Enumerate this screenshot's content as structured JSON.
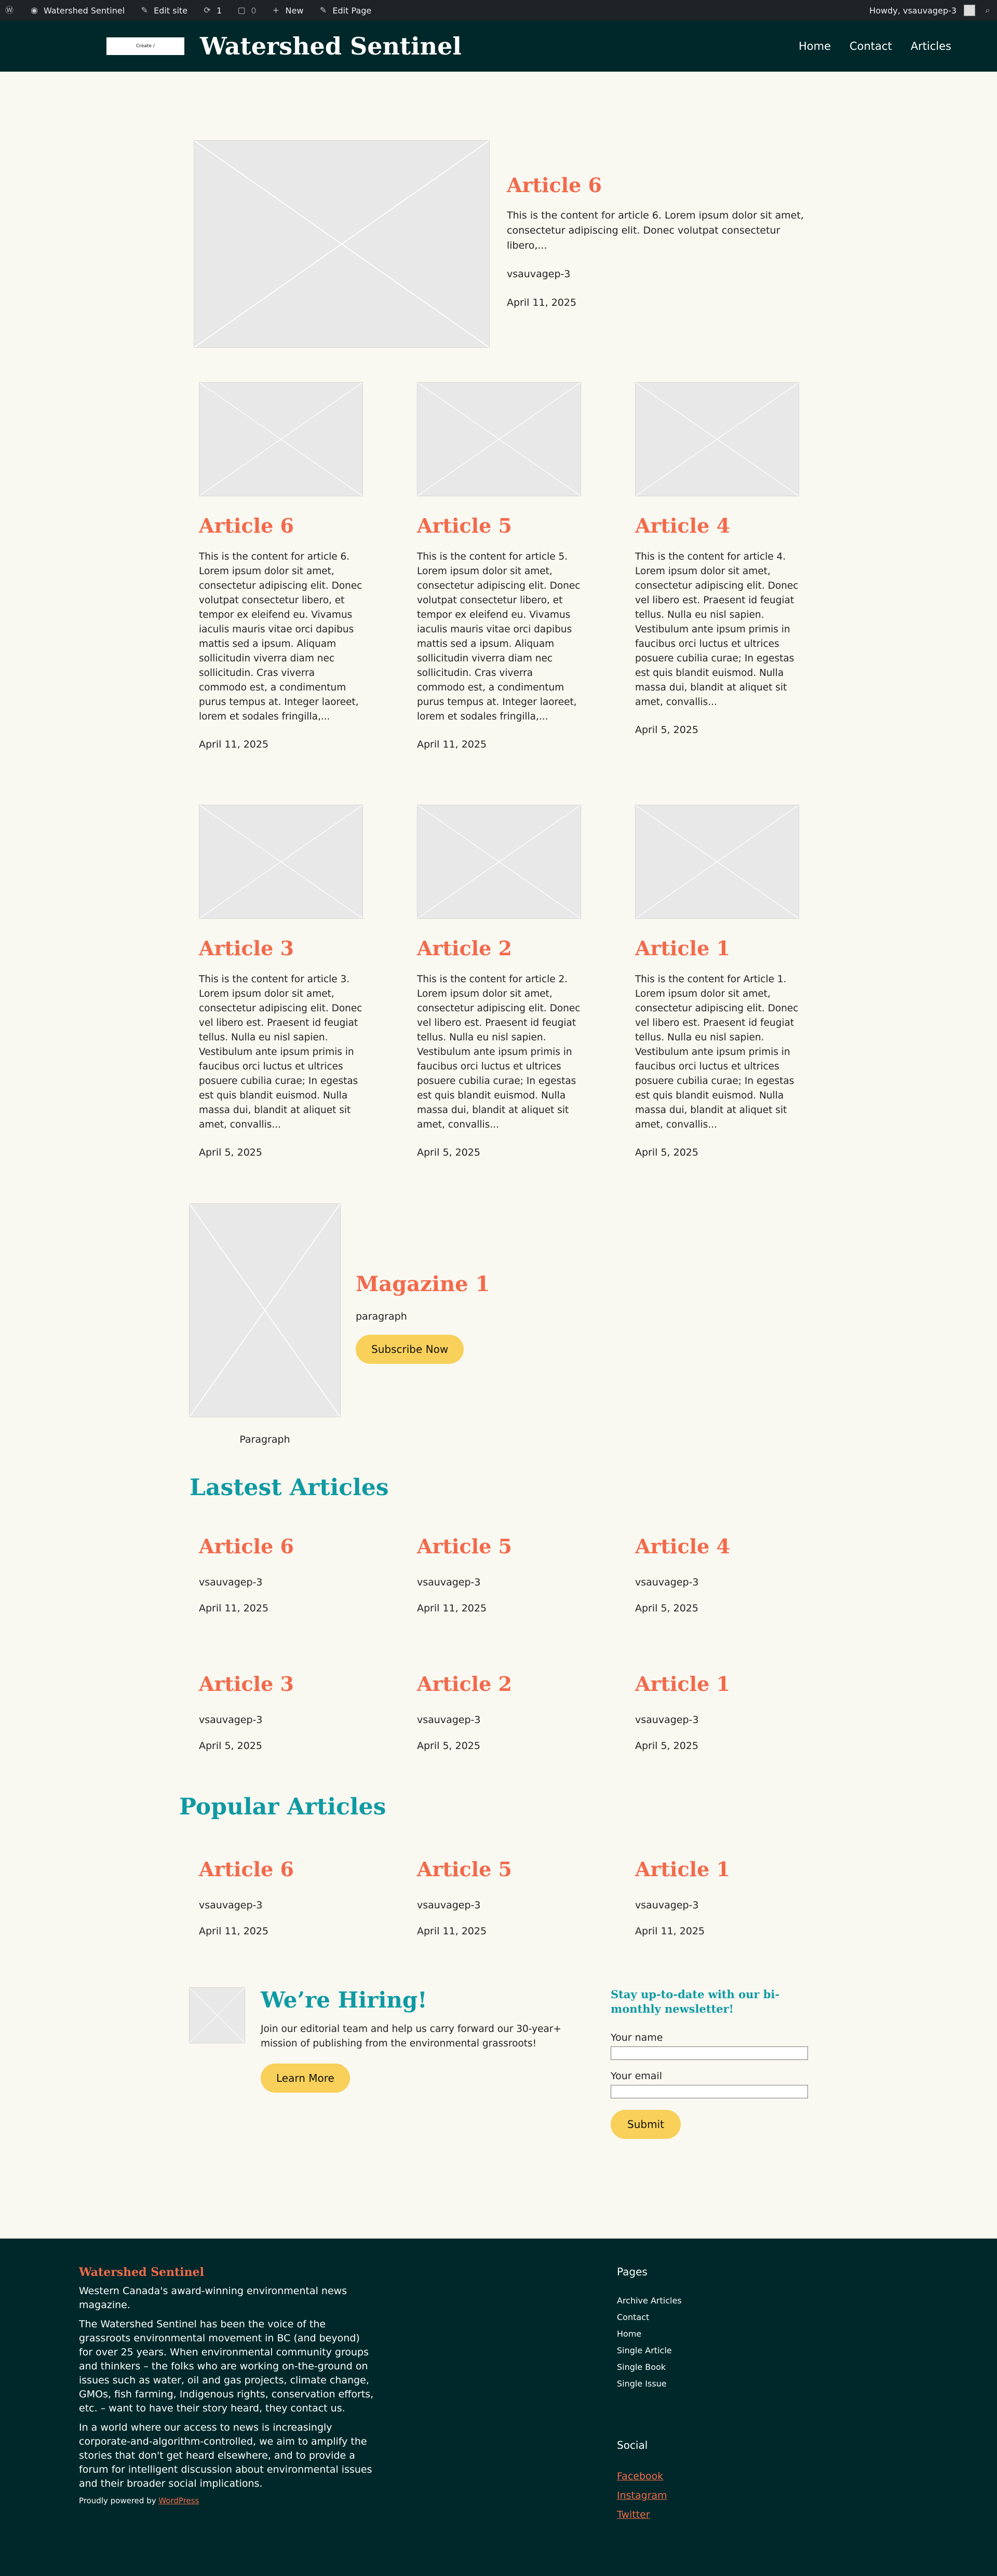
{
  "adminbar": {
    "site": "Watershed Sentinel",
    "edit_site": "Edit site",
    "updates": "1",
    "comments": "0",
    "new": "New",
    "edit_page": "Edit Page",
    "howdy": "Howdy, vsauvagep-3"
  },
  "header": {
    "logo_text": "Create /",
    "title": "Watershed Sentinel",
    "nav": [
      "Home",
      "Contact",
      "Articles"
    ]
  },
  "featured": {
    "title": "Article 6",
    "excerpt": "This is the content for article 6. Lorem ipsum dolor sit amet, consectetur adipiscing elit. Donec volutpat consectetur libero,...",
    "author": "vsauvagep-3",
    "date": "April 11, 2025"
  },
  "grid": [
    {
      "title": "Article 6",
      "excerpt": "This is the content for article 6. Lorem ipsum dolor sit amet, consectetur adipiscing elit. Donec volutpat consectetur libero, et tempor ex eleifend eu. Vivamus iaculis mauris vitae orci dapibus mattis sed a ipsum. Aliquam sollicitudin viverra diam nec sollicitudin. Cras viverra commodo est, a condimentum purus tempus at. Integer laoreet, lorem et sodales fringilla,...",
      "date": "April 11, 2025"
    },
    {
      "title": "Article 5",
      "excerpt": "This is the content for article 5. Lorem ipsum dolor sit amet, consectetur adipiscing elit. Donec volutpat consectetur libero, et tempor ex eleifend eu. Vivamus iaculis mauris vitae orci dapibus mattis sed a ipsum. Aliquam sollicitudin viverra diam nec sollicitudin. Cras viverra commodo est, a condimentum purus tempus at. Integer laoreet, lorem et sodales fringilla,...",
      "date": "April 11, 2025"
    },
    {
      "title": "Article 4",
      "excerpt": "This is the content for article 4. Lorem ipsum dolor sit amet, consectetur adipiscing elit. Donec vel libero est. Praesent id feugiat tellus. Nulla eu nisl sapien. Vestibulum ante ipsum primis in faucibus orci luctus et ultrices posuere cubilia curae; In egestas est quis blandit euismod. Nulla massa dui, blandit at aliquet sit amet, convallis...",
      "date": "April 5, 2025"
    },
    {
      "title": "Article 3",
      "excerpt": "This is the content for article 3. Lorem ipsum dolor sit amet, consectetur adipiscing elit. Donec vel libero est. Praesent id feugiat tellus. Nulla eu nisl sapien. Vestibulum ante ipsum primis in faucibus orci luctus et ultrices posuere cubilia curae; In egestas est quis blandit euismod. Nulla massa dui, blandit at aliquet sit amet, convallis...",
      "date": "April 5, 2025"
    },
    {
      "title": "Article 2",
      "excerpt": "This is the content for article 2. Lorem ipsum dolor sit amet, consectetur adipiscing elit. Donec vel libero est. Praesent id feugiat tellus. Nulla eu nisl sapien. Vestibulum ante ipsum primis in faucibus orci luctus et ultrices posuere cubilia curae; In egestas est quis blandit euismod. Nulla massa dui, blandit at aliquet sit amet, convallis...",
      "date": "April 5, 2025"
    },
    {
      "title": "Article 1",
      "excerpt": "This is the content for Article 1. Lorem ipsum dolor sit amet, consectetur adipiscing elit. Donec vel libero est. Praesent id feugiat tellus. Nulla eu nisl sapien. Vestibulum ante ipsum primis in faucibus orci luctus et ultrices posuere cubilia curae; In egestas est quis blandit euismod. Nulla massa dui, blandit at aliquet sit amet, convallis...",
      "date": "April 5, 2025"
    }
  ],
  "magazine": {
    "title": "Magazine 1",
    "text": "paragraph",
    "button": "Subscribe Now",
    "caption": "Paragraph"
  },
  "latest": {
    "heading": "Lastest Articles",
    "items": [
      {
        "title": "Article 6",
        "author": "vsauvagep-3",
        "date": "April 11, 2025"
      },
      {
        "title": "Article 5",
        "author": "vsauvagep-3",
        "date": "April 11, 2025"
      },
      {
        "title": "Article 4",
        "author": "vsauvagep-3",
        "date": "April 5, 2025"
      },
      {
        "title": "Article 3",
        "author": "vsauvagep-3",
        "date": "April 5, 2025"
      },
      {
        "title": "Article 2",
        "author": "vsauvagep-3",
        "date": "April 5, 2025"
      },
      {
        "title": "Article 1",
        "author": "vsauvagep-3",
        "date": "April 5, 2025"
      }
    ]
  },
  "popular": {
    "heading": "Popular Articles",
    "items": [
      {
        "title": "Article 6",
        "author": "vsauvagep-3",
        "date": "April 11, 2025"
      },
      {
        "title": "Article 5",
        "author": "vsauvagep-3",
        "date": "April 11, 2025"
      },
      {
        "title": "Article 1",
        "author": "vsauvagep-3",
        "date": "April 11, 2025"
      }
    ]
  },
  "hiring": {
    "title": "We’re Hiring!",
    "text": "Join our editorial team and help us carry forward our 30-year+ mission of publishing from the environmental grassroots!",
    "button": "Learn More"
  },
  "newsletter": {
    "title": "Stay up-to-date with our bi-monthly newsletter!",
    "name_label": "Your name",
    "email_label": "Your email",
    "button": "Submit"
  },
  "footer": {
    "brand": "Watershed Sentinel",
    "tagline": "Western Canada's award-winning environmental news magazine.",
    "para1": "The Watershed Sentinel has been the voice of the grassroots environmental movement in BC (and beyond) for over 25 years. When environmental community groups and thinkers – the folks who are working on-the-ground on issues such as water, oil and gas projects, climate change, GMOs, fish farming, Indigenous rights, conservation efforts, etc. – want to have their story heard, they contact us.",
    "para2": "In a world where our access to news is increasingly corporate-and-algorithm-controlled, we aim to amplify the stories that don't get heard elsewhere, and to provide a forum for intelligent discussion about environmental issues and their broader social implications.",
    "powered_prefix": "Proudly powered by ",
    "powered_link": "WordPress",
    "pages_heading": "Pages",
    "pages": [
      "Archive Articles",
      "Contact",
      "Home",
      "Single Article",
      "Single Book",
      "Single Issue"
    ],
    "social_heading": "Social",
    "social": [
      "Facebook",
      "Instagram",
      "Twitter"
    ]
  },
  "colors": {
    "header_bg": "#00282a",
    "accent": "#f26a4b",
    "teal": "#0e9aa3",
    "button": "#f8d05a",
    "page_bg": "#f9f8f1"
  }
}
